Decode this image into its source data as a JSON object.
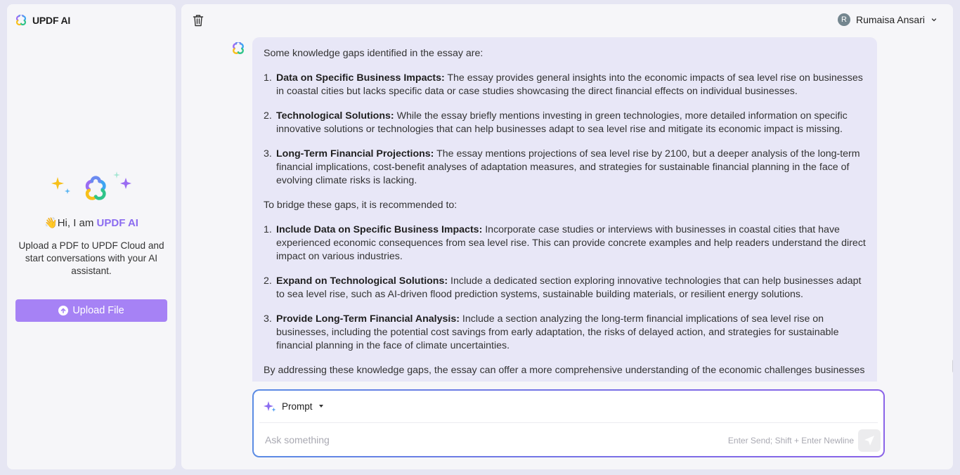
{
  "sidebar": {
    "brand": {
      "title": "UPDF AI",
      "icon": "updf-logo-icon"
    },
    "greeting": {
      "wave": "👋",
      "prefix": "Hi, I am ",
      "name": "UPDF AI"
    },
    "intro": "Upload a PDF to UPDF Cloud and start conversations with your AI assistant.",
    "upload_button": {
      "label": "Upload File",
      "icon": "upload-arrow-icon"
    }
  },
  "header": {
    "trash_icon": "trash-icon",
    "user": {
      "initial": "R",
      "name": "Rumaisa Ansari",
      "icon": "chevron-down-icon"
    }
  },
  "conversation": {
    "messages": [
      {
        "role": "assistant",
        "intro": "Some knowledge gaps identified in the essay are:",
        "gaps": [
          {
            "num": "1.",
            "title": "Data on Specific Business Impacts:",
            "text": " The essay provides general insights into the economic impacts of sea level rise on businesses in coastal cities but lacks specific data or case studies showcasing the direct financial effects on individual businesses."
          },
          {
            "num": "2.",
            "title": "Technological Solutions:",
            "text": " While the essay briefly mentions investing in green technologies, more detailed information on specific innovative solutions or technologies that can help businesses adapt to sea level rise and mitigate its economic impact is missing."
          },
          {
            "num": "3.",
            "title": "Long-Term Financial Projections:",
            "text": " The essay mentions projections of sea level rise by 2100, but a deeper analysis of the long-term financial implications, cost-benefit analyses of adaptation measures, and strategies for sustainable financial planning in the face of evolving climate risks is lacking."
          }
        ],
        "bridge": "To bridge these gaps, it is recommended to:",
        "recommendations": [
          {
            "num": "1.",
            "title": "Include Data on Specific Business Impacts:",
            "text": " Incorporate case studies or interviews with businesses in coastal cities that have experienced economic consequences from sea level rise. This can provide concrete examples and help readers understand the direct impact on various industries."
          },
          {
            "num": "2.",
            "title": "Expand on Technological Solutions:",
            "text": " Include a dedicated section exploring innovative technologies that can help businesses adapt to sea level rise, such as AI-driven flood prediction systems, sustainable building materials, or resilient energy solutions."
          },
          {
            "num": "3.",
            "title": "Provide Long-Term Financial Analysis:",
            "text": " Include a section analyzing the long-term financial implications of sea level rise on businesses, including the potential cost savings from early adaptation, the risks of delayed action, and strategies for sustainable financial planning in the face of climate uncertainties."
          }
        ],
        "closing": "By addressing these knowledge gaps, the essay can offer a more comprehensive understanding of the economic challenges businesses"
      }
    ]
  },
  "composer": {
    "mode_label": "Prompt",
    "mode_icon": "sparkle-icon",
    "input_value": "",
    "placeholder": "Ask something",
    "hint": "Enter Send; Shift + Enter Newline",
    "send_icon": "send-icon"
  },
  "colors": {
    "accent": "#8b6cf0",
    "upload_button": "#a682f5",
    "bubble_bg": "#e8e7f7",
    "app_bg": "#e6e6f3",
    "panel_bg": "#f6f6f9"
  }
}
